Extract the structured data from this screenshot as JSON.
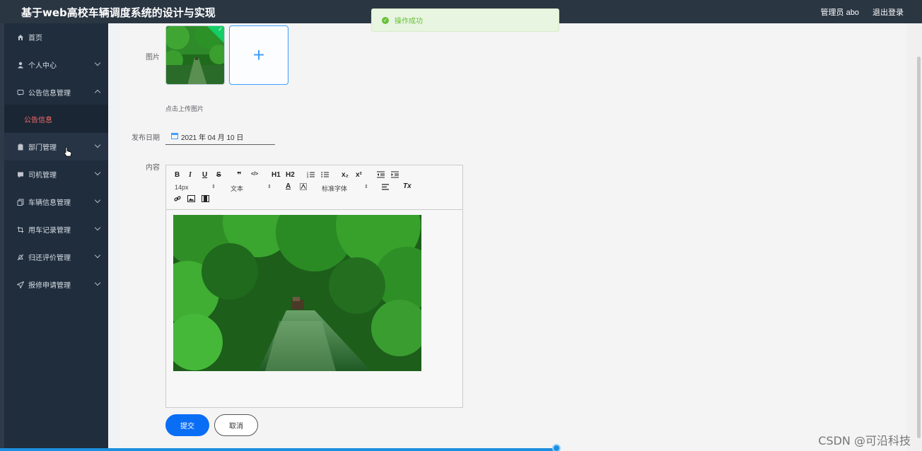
{
  "header": {
    "app_title": "基于web高校车辆调度系统的设计与实现",
    "user_label": "管理员 abo",
    "logout_label": "退出登录"
  },
  "sidebar": {
    "items": [
      {
        "label": "首页",
        "icon": "home-icon"
      },
      {
        "label": "个人中心",
        "icon": "user-icon"
      },
      {
        "label": "公告信息管理",
        "icon": "chat-icon"
      },
      {
        "label": "部门管理",
        "icon": "clipboard-icon"
      },
      {
        "label": "司机管理",
        "icon": "message-icon"
      },
      {
        "label": "车辆信息管理",
        "icon": "copy-icon"
      },
      {
        "label": "用车记录管理",
        "icon": "crop-icon"
      },
      {
        "label": "归还评价管理",
        "icon": "bell-off-icon"
      },
      {
        "label": "报修申请管理",
        "icon": "send-icon"
      }
    ],
    "submenu_active": "公告信息"
  },
  "form": {
    "image_label": "图片",
    "upload_plus": "+",
    "upload_tip": "点击上传图片",
    "date_label": "发布日期",
    "date_value": "2021 年 04 月 10 日",
    "content_label": "内容",
    "submit_label": "提交",
    "cancel_label": "取消"
  },
  "editor": {
    "font_size": "14px",
    "block_type": "文本",
    "font_family": "标准字体",
    "buttons": [
      "B",
      "I",
      "U",
      "S",
      "❞",
      "</>",
      "H1",
      "H2",
      "ordered-list",
      "bullet-list",
      "x₂",
      "x²",
      "outdent",
      "indent",
      "A",
      "background",
      "align",
      "Tx",
      "link",
      "image",
      "video"
    ]
  },
  "toast": {
    "message": "操作成功",
    "color": "#67c23a"
  },
  "watermark": "CSDN @可沿科技",
  "colors": {
    "header_bg": "#2b3643",
    "sidebar_bg": "#1f2d3d",
    "primary": "#0a6ef5",
    "active_sub": "#f56c6c"
  }
}
